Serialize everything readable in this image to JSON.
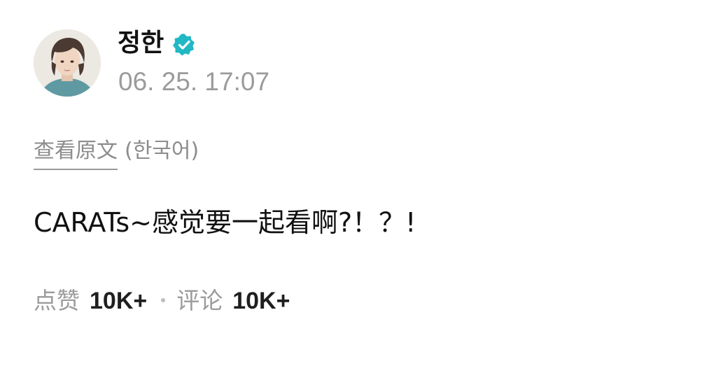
{
  "post": {
    "author": {
      "name": "정한",
      "verified": true,
      "verified_color": "#21b8c4"
    },
    "timestamp": "06. 25. 17:07",
    "translation": {
      "view_original_label": "查看原文",
      "language_label": "(한국어)"
    },
    "content": "CARATs~感觉要一起看啊?！？!",
    "stats": {
      "likes_label": "点赞",
      "likes_value": "10K+",
      "comments_label": "评论",
      "comments_value": "10K+"
    }
  },
  "icons": {
    "verified": "verified-badge-icon",
    "avatar": "profile-photo"
  }
}
